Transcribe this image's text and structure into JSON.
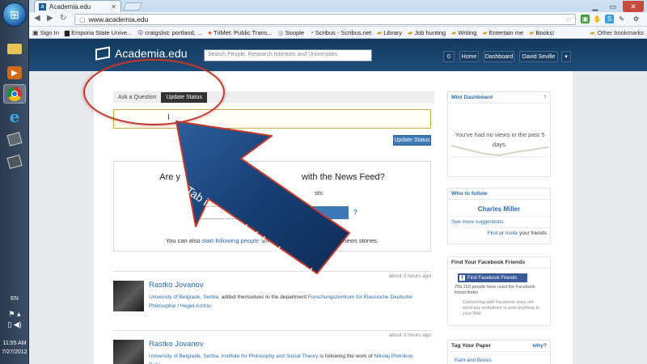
{
  "taskbar": {
    "lang": "EN",
    "time": "11:55 AM",
    "date": "7/27/2012"
  },
  "browser": {
    "tab_title": "Academia.edu",
    "tab_favicon": "a",
    "url": "www.academia.edu",
    "bookmarks": [
      {
        "label": "Sign In",
        "icon": "page-icon"
      },
      {
        "label": "Emporia State Unive...",
        "icon": "page-icon"
      },
      {
        "label": "craigslist: portland, ...",
        "icon": "peace-icon"
      },
      {
        "label": "TriMet: Public Trans...",
        "icon": "trimet-icon"
      },
      {
        "label": "Soople",
        "icon": "page-icon"
      },
      {
        "label": "Scribus - Scribus.net",
        "icon": "page-icon"
      },
      {
        "label": "Library",
        "icon": "folder-icon"
      },
      {
        "label": "Job hunting",
        "icon": "folder-icon"
      },
      {
        "label": "Writing",
        "icon": "folder-icon"
      },
      {
        "label": "Entertain me",
        "icon": "folder-icon"
      },
      {
        "label": "Books!",
        "icon": "folder-icon"
      }
    ],
    "other_bookmarks": "Other bookmarks"
  },
  "site": {
    "logo": "Academia.edu",
    "search_placeholder": "Search People, Research Interests and Universities",
    "header": {
      "count": "0",
      "home": "Home",
      "dashboard": "Dashboard",
      "user": "David Seville"
    },
    "question_tabs": [
      "Ask a Question",
      "Update Status"
    ],
    "update_status_button": "Update Status",
    "news": {
      "question_start": "Are y",
      "question_end": "with the News Feed?",
      "prompt_tail": "sts:",
      "help": "?",
      "more_prefix": "You can also ",
      "more_link1": "start following people",
      "more_mid": " and ",
      "more_link2": "invite",
      "more_suffix": "news stories."
    },
    "feed": [
      {
        "meta": "about 3 hours ago",
        "name": "Rastko Jovanov",
        "affil": "University of Belgrade, Serbia",
        "text": ", added themselves to the department ",
        "link": "Forschungszentrum für Klassische Deutsche Philosophie / Hegel-Archiv",
        "end": "."
      },
      {
        "meta": "about 3 hours ago",
        "name": "Rastko Jovanov",
        "affil": "University of Belgrade, Serbia, Institute for Philosophy and Social Theory",
        "text": " is following the work of ",
        "link": "Nikolaj Plotnikov, Ruhr-",
        "end": ""
      }
    ],
    "sidebar": {
      "mini_dashboard": {
        "title": "Mini Dashboard",
        "help": "?",
        "message": "You've had no views in the past 5 days."
      },
      "who_to_follow": {
        "title": "Who to follow",
        "person": "Charles Miller",
        "more": "See more suggestions",
        "find": "Find",
        "or": " or ",
        "invite": "Invite",
        "friends": " your friends"
      },
      "facebook": {
        "title": "Find Your Facebook Friends",
        "button": "Find Facebook Friends",
        "count_text": "756,159 people have used the Facebook friend finder",
        "note": "Connecting with Facebook does not send any invitations or post anything to your Wall"
      },
      "tag_paper": {
        "title": "Tag Your Paper",
        "why": "why?",
        "item": "Kant and Boxes"
      }
    }
  },
  "annotation": {
    "label": "Tab in use = dark background",
    "color": "#c0392b"
  }
}
